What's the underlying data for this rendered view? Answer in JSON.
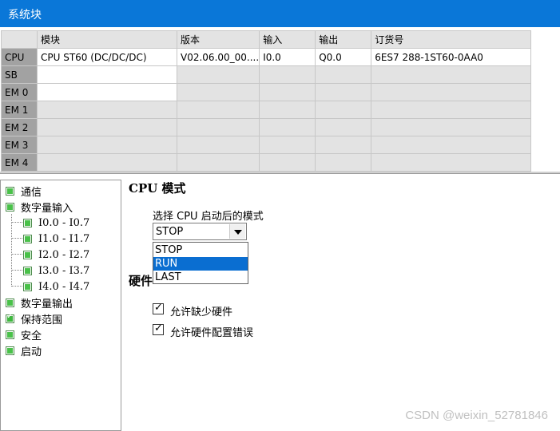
{
  "window": {
    "title": "系统块"
  },
  "hw_table": {
    "headers": [
      "",
      "模块",
      "版本",
      "输入",
      "输出",
      "订货号"
    ],
    "rows": [
      {
        "slot": "CPU",
        "module": "CPU ST60 (DC/DC/DC)",
        "version": "V02.06.00_00....",
        "input": "I0.0",
        "output": "Q0.0",
        "order": "6ES7 288-1ST60-0AA0"
      },
      {
        "slot": "SB",
        "module": "",
        "version": "",
        "input": "",
        "output": "",
        "order": ""
      },
      {
        "slot": "EM 0",
        "module": "",
        "version": "",
        "input": "",
        "output": "",
        "order": ""
      },
      {
        "slot": "EM 1",
        "module": "",
        "version": "",
        "input": "",
        "output": "",
        "order": ""
      },
      {
        "slot": "EM 2",
        "module": "",
        "version": "",
        "input": "",
        "output": "",
        "order": ""
      },
      {
        "slot": "EM 3",
        "module": "",
        "version": "",
        "input": "",
        "output": "",
        "order": ""
      },
      {
        "slot": "EM 4",
        "module": "",
        "version": "",
        "input": "",
        "output": "",
        "order": ""
      }
    ]
  },
  "tree": {
    "items": [
      {
        "label": "通信"
      },
      {
        "label": "数字量输入"
      },
      {
        "label": "I0.0 - I0.7"
      },
      {
        "label": "I1.0 - I1.7"
      },
      {
        "label": "I2.0 - I2.7"
      },
      {
        "label": "I3.0 - I3.7"
      },
      {
        "label": "I4.0 - I4.7"
      },
      {
        "label": "数字量输出"
      },
      {
        "label": "保持范围"
      },
      {
        "label": "安全"
      },
      {
        "label": "启动"
      }
    ]
  },
  "panel": {
    "cpu_mode_title": "CPU 模式",
    "startup_label": "选择 CPU 启动后的模式",
    "startup_value": "STOP",
    "options": [
      "STOP",
      "RUN",
      "LAST"
    ],
    "selected_option": "RUN",
    "hardware_title": "硬件",
    "allow_missing_hw": "允许缺少硬件",
    "allow_hw_config_error": "允许硬件配置错误",
    "allow_missing_hw_checked": true,
    "allow_hw_config_error_checked": true
  },
  "watermark": "CSDN @weixin_52781846",
  "colors": {
    "titlebar": "#0a77d8",
    "selection": "#0a6ed1",
    "tree_box": "#49c149"
  }
}
